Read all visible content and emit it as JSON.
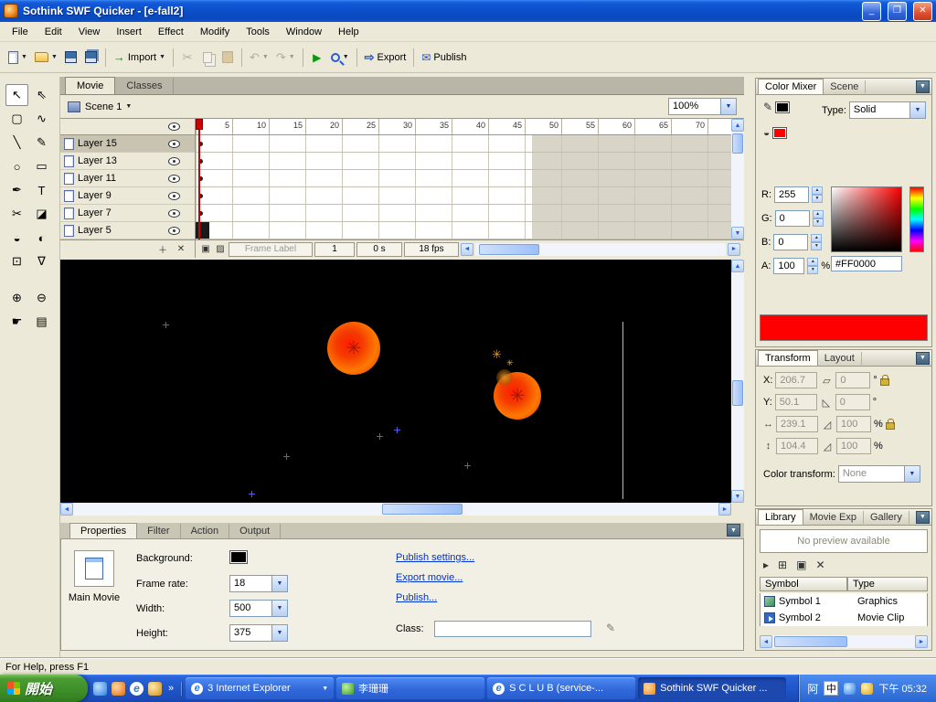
{
  "window": {
    "title": "Sothink SWF Quicker - [e-fall2]",
    "menus": [
      "File",
      "Edit",
      "View",
      "Insert",
      "Effect",
      "Modify",
      "Tools",
      "Window",
      "Help"
    ]
  },
  "toolbar": {
    "import": "Import",
    "export": "Export",
    "publish": "Publish"
  },
  "doc": {
    "tabs": [
      "Movie",
      "Classes"
    ],
    "scene": "Scene 1",
    "zoom": "100%"
  },
  "tools": [
    "↖",
    "⇖",
    "▢",
    "∿",
    "╲",
    "✎",
    "○",
    "▭",
    "✒",
    "T",
    "✂",
    "◪",
    "◒",
    "◐",
    "⊡",
    "∇",
    "⊕",
    "⊖",
    "☛",
    "▤"
  ],
  "timeline": {
    "layers": [
      "Layer 15",
      "Layer 13",
      "Layer 11",
      "Layer 9",
      "Layer 7",
      "Layer 5"
    ],
    "ruler": [
      "5",
      "10",
      "15",
      "20",
      "25",
      "30",
      "35",
      "40",
      "45",
      "50",
      "55",
      "60",
      "65",
      "70"
    ],
    "frame_label": "Frame Label",
    "frame": "1",
    "time": "0 s",
    "fps": "18 fps"
  },
  "stage": {
    "background": "#000000"
  },
  "properties": {
    "tabs": [
      "Properties",
      "Filter",
      "Action",
      "Output"
    ],
    "main_movie": "Main Movie",
    "background_label": "Background:",
    "frame_rate_label": "Frame rate:",
    "frame_rate": "18",
    "width_label": "Width:",
    "width": "500",
    "height_label": "Height:",
    "height": "375",
    "publish_settings": "Publish settings...",
    "export_movie": "Export movie...",
    "publish": "Publish...",
    "class_label": "Class:"
  },
  "color_mixer": {
    "tabs": [
      "Color Mixer",
      "Scene"
    ],
    "type_label": "Type:",
    "type": "Solid",
    "r_label": "R:",
    "r": "255",
    "g_label": "G:",
    "g": "0",
    "b_label": "B:",
    "b": "0",
    "a_label": "A:",
    "a": "100",
    "percent": "%",
    "hex": "#FF0000",
    "color": "#FF0000"
  },
  "transform": {
    "tabs": [
      "Transform",
      "Layout"
    ],
    "x_label": "X:",
    "x": "206.7",
    "y_label": "Y:",
    "y": "50.1",
    "w": "239.1",
    "h": "104.4",
    "rot_x": "0",
    "rot_y": "0",
    "scale_x": "100",
    "scale_y": "100",
    "deg": "°",
    "pct": "%",
    "color_transform_label": "Color transform:",
    "color_transform": "None"
  },
  "library": {
    "tabs": [
      "Library",
      "Movie Exp",
      "Gallery"
    ],
    "preview": "No preview available",
    "col_symbol": "Symbol",
    "col_type": "Type",
    "items": [
      {
        "name": "Symbol 1",
        "type": "Graphics"
      },
      {
        "name": "Symbol 2",
        "type": "Movie Clip"
      }
    ]
  },
  "status": {
    "text": "For Help, press F1"
  },
  "taskbar": {
    "start": "開始",
    "tasks": [
      "3 Internet Explorer",
      "李珊珊",
      "S C L U B (service-...",
      "Sothink SWF Quicker ..."
    ],
    "ime_a": "阿",
    "ime_b": "中",
    "clock": "下午 05:32"
  }
}
